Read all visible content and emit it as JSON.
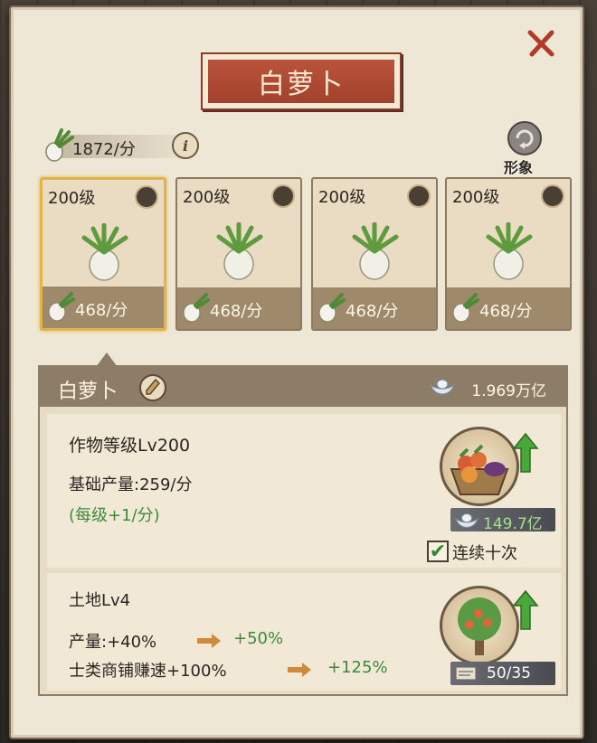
{
  "title": "白萝卜",
  "rate": {
    "value": "1872/分",
    "info_glyph": "i"
  },
  "appearance_label": "形象",
  "cards": [
    {
      "level": "200级",
      "output": "468/分",
      "selected": true
    },
    {
      "level": "200级",
      "output": "468/分",
      "selected": false
    },
    {
      "level": "200级",
      "output": "468/分",
      "selected": false
    },
    {
      "level": "200级",
      "output": "468/分",
      "selected": false
    }
  ],
  "detail": {
    "name": "白萝卜",
    "silver_total": "1.969万亿",
    "crop": {
      "level_label": "作物等级Lv200",
      "base_output": "基础产量:259/分",
      "per_level": "(每级+1/分)",
      "upgrade_cost": "149.7亿",
      "repeat_label": "连续十次",
      "repeat_checked": "✔"
    },
    "land": {
      "level_label": "土地Lv4",
      "output_label": "产量:+40%",
      "output_next": "+50%",
      "shop_label": "士类商铺赚速+100%",
      "shop_next": "+125%",
      "progress": "50/35"
    }
  },
  "colors": {
    "title_red": "#a3412c",
    "accent_gold": "#e0b44a",
    "bonus_green": "#3d8a3a",
    "header_brown": "#8e7d66"
  },
  "icons": {
    "close": "close-icon",
    "radish": "radish-icon",
    "info": "info-icon",
    "appearance": "appearance-icon",
    "silver": "silver-ingot-icon",
    "arrow": "arrow-right-icon"
  }
}
